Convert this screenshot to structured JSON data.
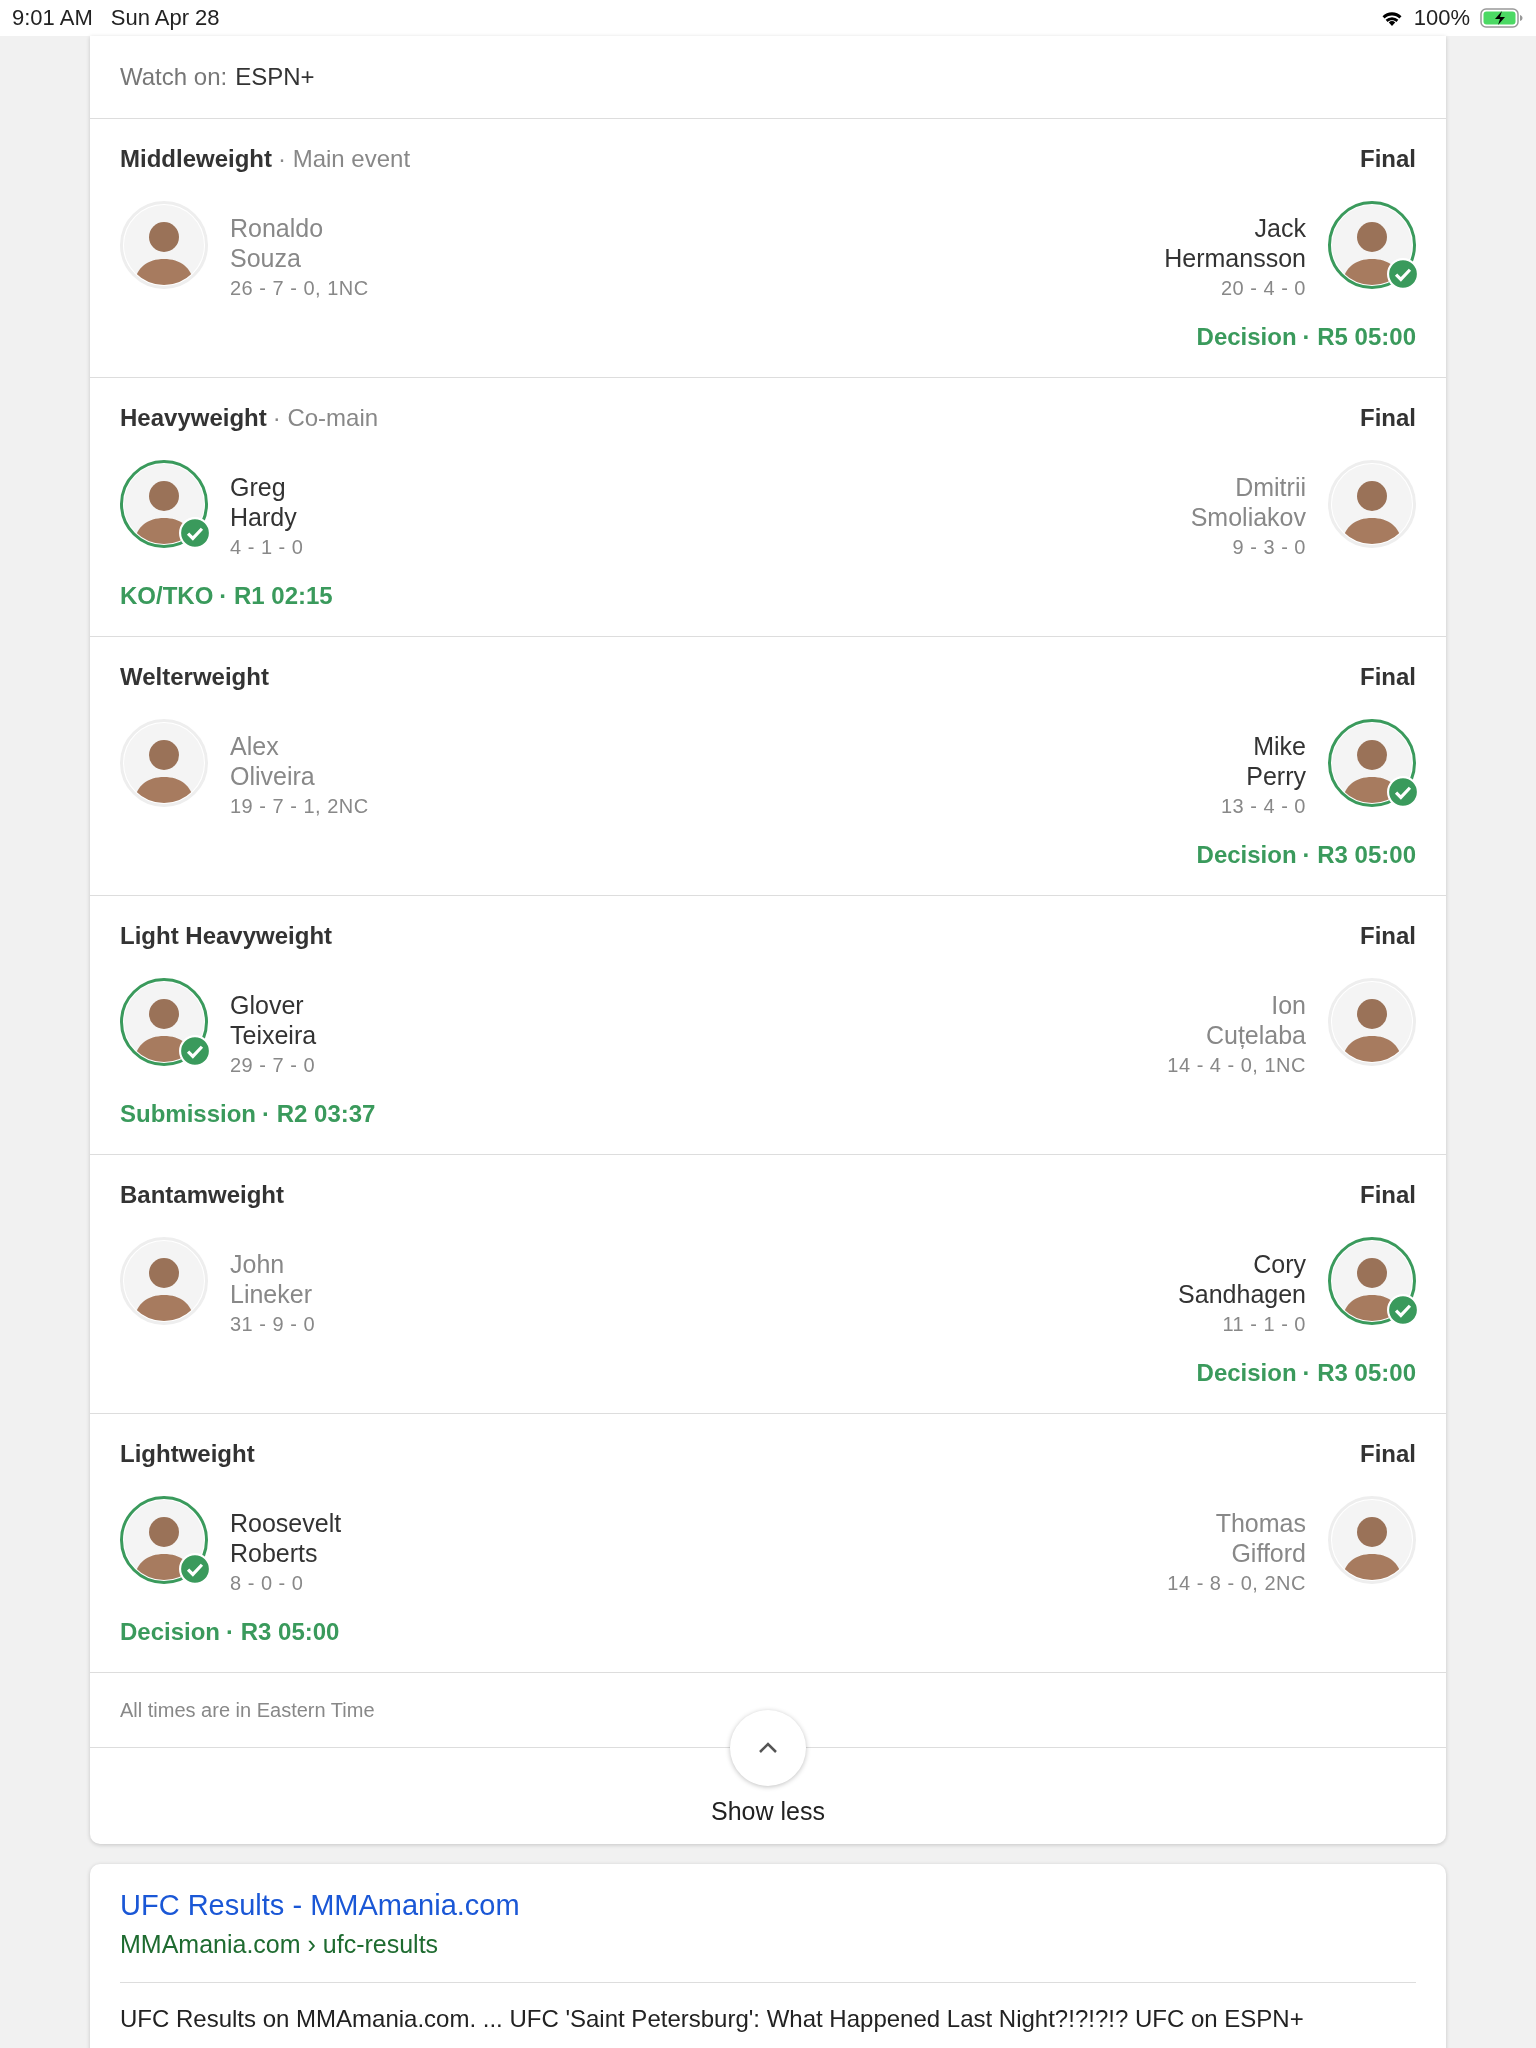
{
  "status_bar": {
    "time": "9:01 AM",
    "date": "Sun Apr 28",
    "battery": "100%"
  },
  "event": {
    "watch_label": "Watch on:",
    "watch_value": "ESPN+"
  },
  "fights": [
    {
      "division": "Middleweight",
      "billing": "· Main event",
      "status": "Final",
      "method": "Decision",
      "time": "· R5 05:00",
      "fighters": [
        {
          "first": "Ronaldo",
          "last": "Souza",
          "record": "26 - 7 - 0, 1NC",
          "winner": false
        },
        {
          "first": "Jack",
          "last": "Hermansson",
          "record": "20 - 4 - 0",
          "winner": true
        }
      ]
    },
    {
      "division": "Heavyweight",
      "billing": "· Co-main",
      "status": "Final",
      "method": "KO/TKO",
      "time": "· R1 02:15",
      "fighters": [
        {
          "first": "Greg",
          "last": "Hardy",
          "record": "4 - 1 - 0",
          "winner": true
        },
        {
          "first": "Dmitrii",
          "last": "Smoliakov",
          "record": "9 - 3 - 0",
          "winner": false
        }
      ]
    },
    {
      "division": "Welterweight",
      "status": "Final",
      "method": "Decision",
      "time": "· R3 05:00",
      "fighters": [
        {
          "first": "Alex",
          "last": "Oliveira",
          "record": "19 - 7 - 1, 2NC",
          "winner": false
        },
        {
          "first": "Mike",
          "last": "Perry",
          "record": "13 - 4 - 0",
          "winner": true
        }
      ]
    },
    {
      "division": "Light Heavyweight",
      "status": "Final",
      "method": "Submission",
      "time": "· R2 03:37",
      "fighters": [
        {
          "first": "Glover",
          "last": "Teixeira",
          "record": "29 - 7 - 0",
          "winner": true
        },
        {
          "first": "Ion",
          "last": "Cuțelaba",
          "record": "14 - 4 - 0, 1NC",
          "winner": false
        }
      ]
    },
    {
      "division": "Bantamweight",
      "status": "Final",
      "method": "Decision",
      "time": "· R3 05:00",
      "fighters": [
        {
          "first": "John",
          "last": "Lineker",
          "record": "31 - 9 - 0",
          "winner": false
        },
        {
          "first": "Cory",
          "last": "Sandhagen",
          "record": "11 - 1 - 0",
          "winner": true
        }
      ]
    },
    {
      "division": "Lightweight",
      "status": "Final",
      "method": "Decision",
      "time": "· R3 05:00",
      "fighters": [
        {
          "first": "Roosevelt",
          "last": "Roberts",
          "record": "8 - 0 - 0",
          "winner": true
        },
        {
          "first": "Thomas",
          "last": "Gifford",
          "record": "14 - 8 - 0, 2NC",
          "winner": false
        }
      ]
    }
  ],
  "footnote": "All times are in Eastern Time",
  "toggle": {
    "label": "Show less"
  },
  "result": {
    "title": "UFC Results - MMAmania.com",
    "breadcrumb": "MMAmania.com › ufc-results",
    "snippet": "UFC Results on MMAmania.com. ... UFC 'Saint Petersburg': What Happened Last Night?!?!?!? UFC on ESPN+"
  }
}
